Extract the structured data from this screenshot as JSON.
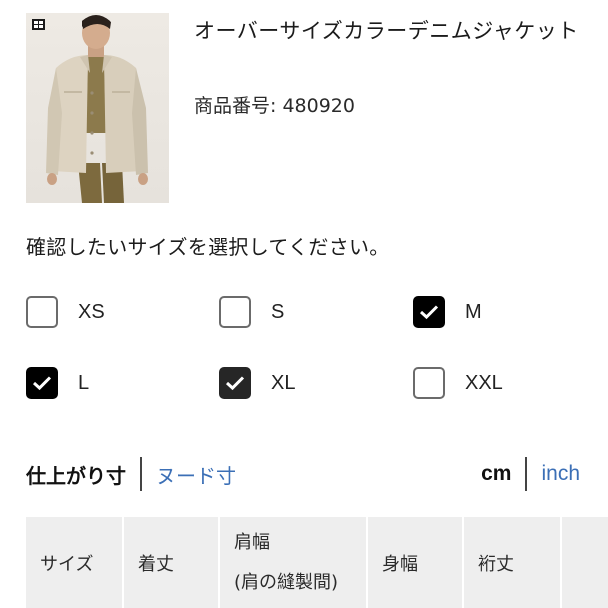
{
  "product": {
    "name": "オーバーサイズカラーデニムジャケット",
    "code": "商品番号: 480920",
    "image_alt": "product-photo"
  },
  "size_selector": {
    "prompt": "確認したいサイズを選択してください。",
    "options": [
      {
        "label": "XS",
        "checked": false
      },
      {
        "label": "S",
        "checked": false
      },
      {
        "label": "M",
        "checked": true
      },
      {
        "label": "L",
        "checked": true
      },
      {
        "label": "XL",
        "checked": true
      },
      {
        "label": "XXL",
        "checked": false
      }
    ]
  },
  "measurement_tabs": {
    "active": "仕上がり寸",
    "other": "ヌード寸"
  },
  "units": {
    "active": "cm",
    "other": "inch"
  },
  "size_table": {
    "headers": [
      {
        "line1": "サイズ",
        "line2": ""
      },
      {
        "line1": "着丈",
        "line2": ""
      },
      {
        "line1": "肩幅",
        "line2": "(肩の縫製間)"
      },
      {
        "line1": "身幅",
        "line2": ""
      },
      {
        "line1": "裄丈",
        "line2": ""
      }
    ]
  },
  "colors": {
    "link": "#3b6fb6",
    "checked": "#000000",
    "table_header_bg": "#eeeeee"
  }
}
